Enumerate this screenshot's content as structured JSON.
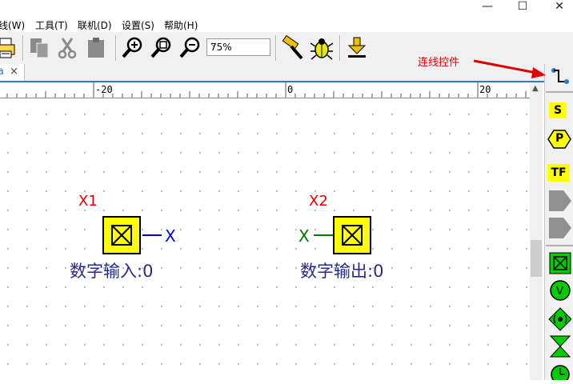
{
  "window": {
    "controls": {
      "minimize": "—",
      "maximize": "☐",
      "close": "✕"
    }
  },
  "menu": {
    "items": [
      "线(W)",
      "工具(T)",
      "联机(D)",
      "设置(S)",
      "帮助(H)"
    ]
  },
  "toolbar": {
    "zoom_value": "75%",
    "buttons": [
      "print",
      "copy",
      "cut",
      "paste",
      "zoom-in",
      "zoom-fit",
      "zoom-out",
      "compile",
      "debug",
      "download"
    ]
  },
  "tab": {
    "close": "×"
  },
  "ruler": {
    "labels": [
      "-20",
      "0",
      "20"
    ]
  },
  "canvas": {
    "blocks": [
      {
        "tag": "X1",
        "port": "X",
        "label": "数字输入:0",
        "port_color": "#0000cc"
      },
      {
        "tag": "X2",
        "port": "X",
        "label": "数字输出:0",
        "port_color": "#007700"
      }
    ]
  },
  "annotation": {
    "text": "连线控件"
  },
  "right_panel": {
    "items": [
      {
        "name": "wire",
        "label": ""
      },
      {
        "name": "S",
        "label": "S"
      },
      {
        "name": "P",
        "label": "P"
      },
      {
        "name": "TF",
        "label": "TF"
      }
    ]
  },
  "colors": {
    "accent_red": "#e00000",
    "block_yellow": "#ffff00",
    "label_blue": "#2a2a8a"
  }
}
